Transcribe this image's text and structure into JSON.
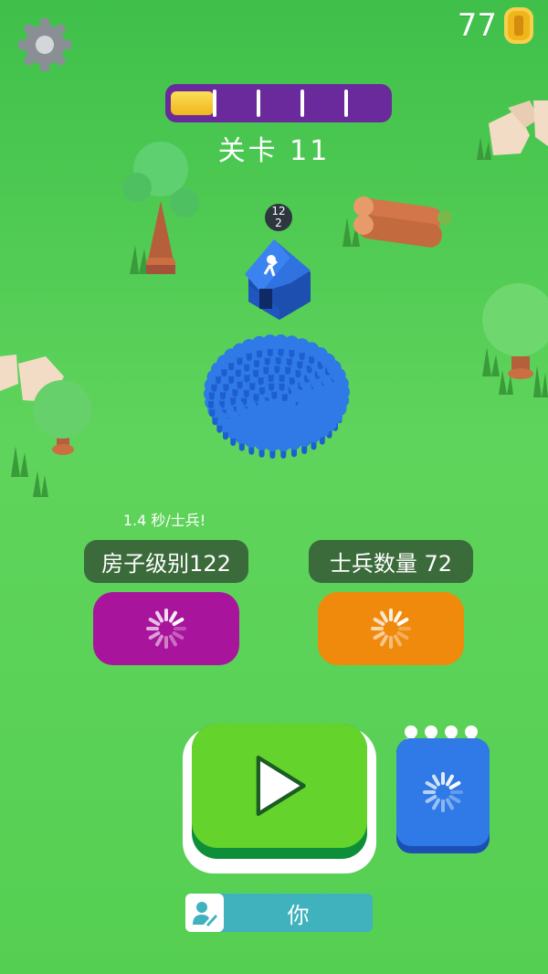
{
  "hud": {
    "coin_count": "77",
    "level_label": "关卡 11",
    "level_progress_fraction": 0.2,
    "progress_segments": 5
  },
  "house": {
    "badge_line1": "12",
    "badge_line2": "2"
  },
  "upgrades": {
    "rate_label": "1.4 秒/士兵!",
    "house_level_label": "房子级别122",
    "soldier_count_label": "士兵数量 72"
  },
  "player": {
    "name": "你"
  },
  "colors": {
    "grass": "#55cf52",
    "progress_bg": "#6a2a9c",
    "progress_fill": "#f2b61d",
    "magenta_button": "#a8149c",
    "orange_button": "#f08a0c",
    "play_button": "#64d32c",
    "crowd_blue": "#2f7ae6",
    "name_bar": "#3fb2bd"
  },
  "icons": {
    "settings": "gear-icon",
    "coin": "coin-icon",
    "play": "play-icon",
    "loading": "spinner-icon",
    "avatar": "user-edit-icon",
    "crowd": "people-icon"
  }
}
